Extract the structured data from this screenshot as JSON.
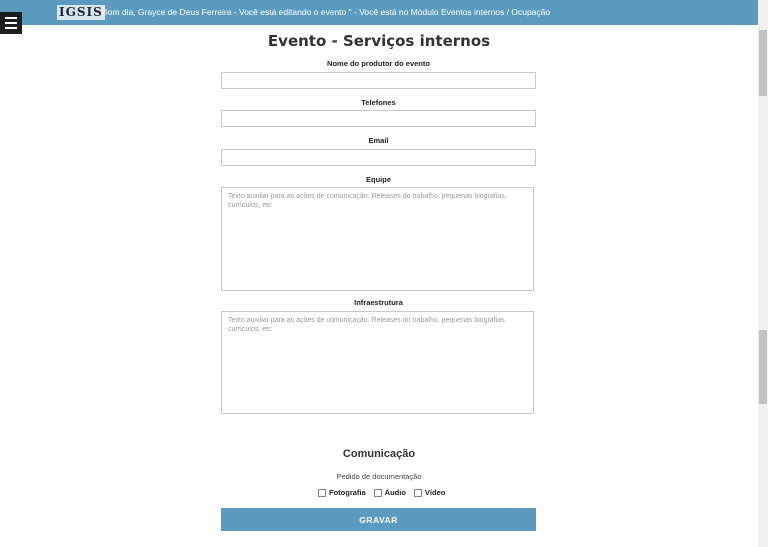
{
  "header": {
    "logo": "IGSIS",
    "greeting": "Bom dia, Grayce de Deus Ferreira - Você está editando o evento \" - Você está no Módulo Eventos internos / Ocupação"
  },
  "page": {
    "title": "Evento - Serviços internos"
  },
  "form": {
    "producer_label": "Nome do produtor do evento",
    "phones_label": "Telefones",
    "email_label": "Email",
    "team_label": "Equipe",
    "team_placeholder": "Texto auxiliar para as ações de comunicação. Releases do trabalho, pequenas biografias, currículos, etc",
    "infra_label": "Infraestrutura",
    "infra_placeholder": "Texto auxiliar para as ações de comunicação. Releases do trabalho, pequenas biografias, currículos, etc"
  },
  "communication": {
    "title": "Comunicação",
    "subtitle": "Pedido de documentação",
    "options": [
      "Fotografia",
      "Áudio",
      "Vídeo"
    ]
  },
  "actions": {
    "save": "GRAVAR"
  },
  "icons": {
    "menu": "hamburger-menu-icon"
  },
  "colors": {
    "accent": "#5a9bbf"
  }
}
